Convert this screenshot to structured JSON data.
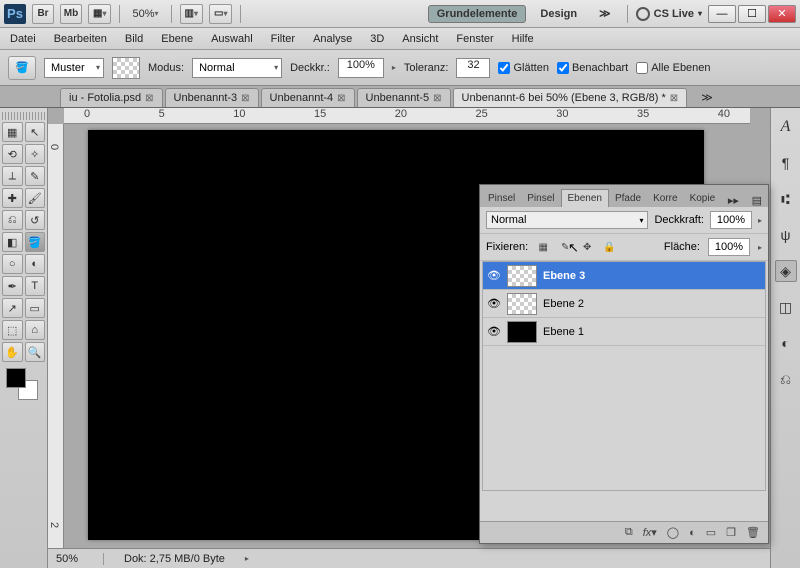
{
  "title_buttons": {
    "br": "Br",
    "mb": "Mb"
  },
  "zoom_title": "50%",
  "workspaces": {
    "active": "Grundelemente",
    "second": "Design"
  },
  "cslive": "CS Live",
  "menu": [
    "Datei",
    "Bearbeiten",
    "Bild",
    "Ebene",
    "Auswahl",
    "Filter",
    "Analyse",
    "3D",
    "Ansicht",
    "Fenster",
    "Hilfe"
  ],
  "optbar": {
    "muster": "Muster",
    "modus_label": "Modus:",
    "modus_value": "Normal",
    "deckkr_label": "Deckkr.:",
    "deckkr_value": "100%",
    "toleranz_label": "Toleranz:",
    "toleranz_value": "32",
    "glatt": "Glätten",
    "benachbart": "Benachbart",
    "alle_ebenen": "Alle Ebenen"
  },
  "tabs": [
    {
      "label": "iu - Fotolia.psd",
      "active": false
    },
    {
      "label": "Unbenannt-3",
      "active": false
    },
    {
      "label": "Unbenannt-4",
      "active": false
    },
    {
      "label": "Unbenannt-5",
      "active": false
    },
    {
      "label": "Unbenannt-6 bei 50% (Ebene 3, RGB/8) *",
      "active": true
    }
  ],
  "ruler_h": [
    "0",
    "5",
    "10",
    "15",
    "20",
    "25",
    "30",
    "35",
    "40"
  ],
  "ruler_v": [
    "0",
    "2"
  ],
  "status": {
    "zoom": "50%",
    "dok": "Dok: 2,75 MB/0 Byte"
  },
  "panel": {
    "tabs": [
      "Pinsel",
      "Pinsel",
      "Ebenen",
      "Pfade",
      "Korre",
      "Kopie"
    ],
    "active_tab": 2,
    "blend": "Normal",
    "opacity_label": "Deckkraft:",
    "opacity": "100%",
    "fix_label": "Fixieren:",
    "fill_label": "Fläche:",
    "fill": "100%",
    "layers": [
      {
        "name": "Ebene 3",
        "thumb": "checker",
        "selected": true
      },
      {
        "name": "Ebene 2",
        "thumb": "checker",
        "selected": false
      },
      {
        "name": "Ebene 1",
        "thumb": "black",
        "selected": false
      }
    ]
  }
}
